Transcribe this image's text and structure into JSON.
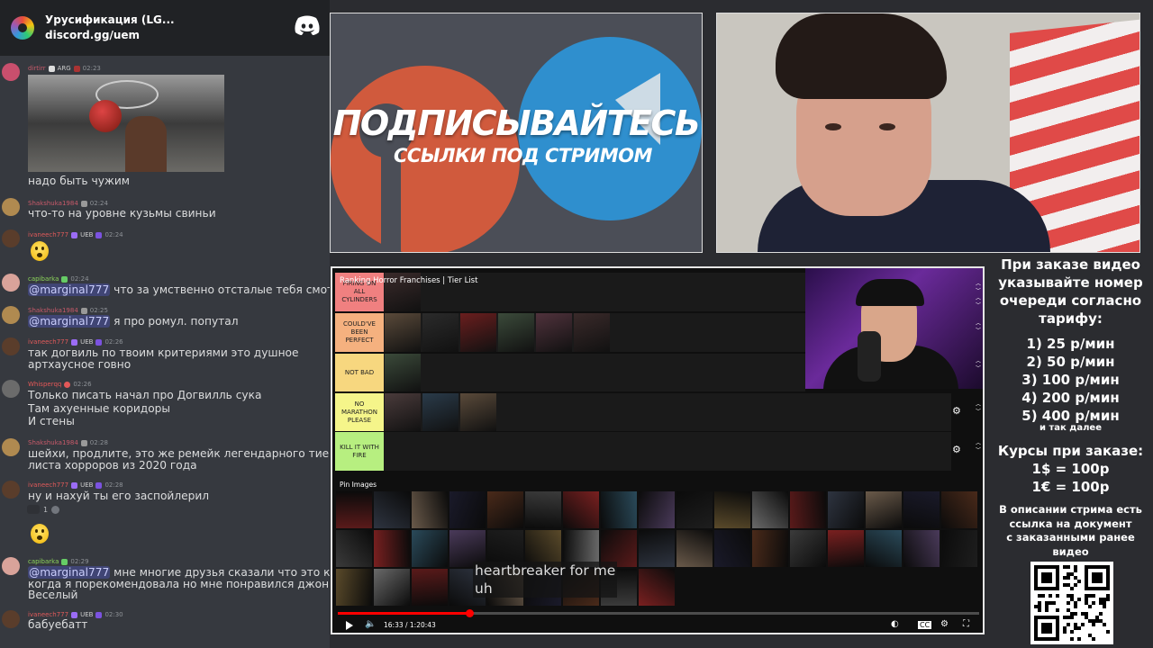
{
  "chat": {
    "server_name": "Урусификация (LG...",
    "server_link": "discord.gg/uem",
    "messages": [
      {
        "user": "dirtirr",
        "user_color": "#c85a6a",
        "badges": [
          "ARG"
        ],
        "time": "02:23",
        "has_embed": true,
        "lines": [
          "надо быть чужим"
        ]
      },
      {
        "user": "Shakshuka1984",
        "user_color": "#c85a6a",
        "time": "02:24",
        "lines": [
          "что-то на уровне кузьмы свиньи"
        ]
      },
      {
        "user": "ivaneech777",
        "user_color": "#9b6cf5",
        "badges": [
          "UEB"
        ],
        "time": "02:24",
        "emoji": true
      },
      {
        "user": "capibarka",
        "user_color": "#8bd45a",
        "time": "02:24",
        "mention": "@marginal777",
        "lines": [
          " что за умственно отсталые тебя смотря"
        ]
      },
      {
        "user": "Shakshuka1984",
        "user_color": "#c85a6a",
        "time": "02:25",
        "mention": "@marginal777",
        "lines": [
          " я про ромул. попутал"
        ]
      },
      {
        "user": "ivaneech777",
        "user_color": "#9b6cf5",
        "badges": [
          "UEB"
        ],
        "time": "02:26",
        "lines": [
          "так догвиль по твоим критериями это душное",
          "артхаусное говно"
        ]
      },
      {
        "user": "Whisperqq",
        "user_color": "#e45858",
        "time": "02:26",
        "lines": [
          "Только писать начал про Догвилль сука",
          "Там ахуенные коридоры",
          "И стены"
        ]
      },
      {
        "user": "Shakshuka1984",
        "user_color": "#c85a6a",
        "time": "02:28",
        "lines": [
          "шейхи, продлите, это же ремейк легендарного тиер",
          "листа хорроров из 2020 года"
        ]
      },
      {
        "user": "ivaneech777",
        "user_color": "#9b6cf5",
        "badges": [
          "UEB"
        ],
        "time": "02:28",
        "lines": [
          "ну и нахуй ты его заспойлерил"
        ],
        "reaction_count": "1"
      },
      {
        "user": "capibarka",
        "user_color": "#8bd45a",
        "time": "02:29",
        "mention": "@marginal777",
        "lines": [
          " мне многие друзья сказали что это кал",
          "когда я порекомендовала но мне понравился джон.",
          "Веселый"
        ]
      },
      {
        "user": "ivaneech777",
        "user_color": "#9b6cf5",
        "badges": [
          "UEB"
        ],
        "time": "02:30",
        "lines": [
          "бабуебатт"
        ]
      }
    ]
  },
  "promo": {
    "line1": "ПОДПИСЫВАЙТЕСЬ",
    "line2": "ССЫЛКИ ПОД СТРИМОМ"
  },
  "player": {
    "title": "Ranking Horror Franchises | Tier List",
    "tiers": [
      {
        "label": "FIRING ON ALL CYLINDERS",
        "color": "#f08080",
        "count": 1
      },
      {
        "label": "COULD'VE BEEN PERFECT",
        "color": "#f5b17f",
        "count": 6
      },
      {
        "label": "NOT BAD",
        "color": "#f7d77f",
        "count": 1
      },
      {
        "label": "NO MARATHON PLEASE",
        "color": "#f5f58a",
        "count": 3
      },
      {
        "label": "KILL IT WITH FIRE",
        "color": "#b7ef80",
        "count": 0
      }
    ],
    "pin_label": "Pin Images",
    "caption_line1": "heartbreaker for me",
    "caption_line2": "uh",
    "time": "16:33 / 1:20:43",
    "progress": 0.205
  },
  "info": {
    "order_text": "При заказе видео указывайте номер очереди согласно тарифу:",
    "prices": [
      "1) 25 р/мин",
      "2) 50 р/мин",
      "3) 100 р/мин",
      "4) 200 р/мин",
      "5) 400 р/мин"
    ],
    "etc": "и так далее",
    "courses_title": "Курсы при заказе:",
    "course_usd": "1$ = 100р",
    "course_eur": "1€ = 100р",
    "desc": "В описании стрима есть\nссылка на документ\nс заказанными ранее\nвидео"
  },
  "colors": {
    "discord_bg": "#36393f",
    "accent_red": "#ff0000",
    "telegram_blue": "#2f8fce",
    "patreon_orange": "#d05a3d"
  }
}
